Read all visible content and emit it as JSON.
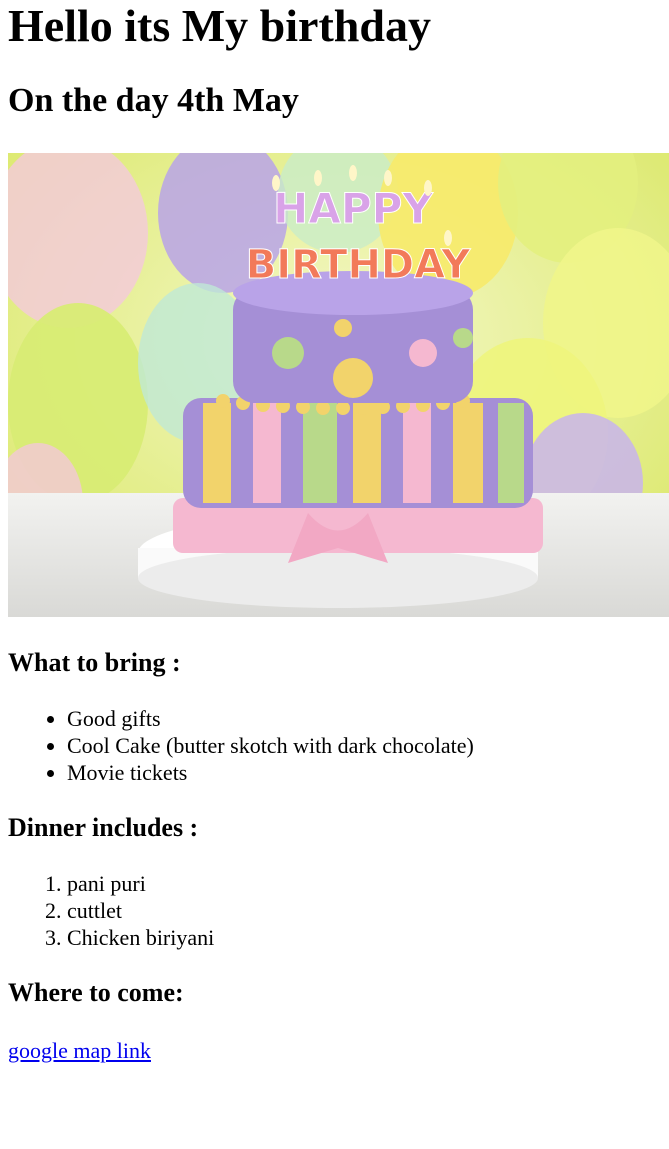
{
  "page": {
    "title": "Hello its My birthday",
    "subtitle": "On the day 4th May"
  },
  "hero_image": {
    "description_icon": "birthday-cake-icon",
    "cake_text_line1": "HAPPY",
    "cake_text_line2": "BIRTHDAY",
    "colors": {
      "background_yellow": "#e8f27a",
      "balloon_purple": "#b9a3e8",
      "cake_purple": "#a58fd6",
      "stripe_yellow": "#f2d36b",
      "stripe_green": "#b8d98a",
      "ribbon_pink": "#f5b8d0"
    }
  },
  "bring": {
    "heading": "What to bring :",
    "items": [
      "Good gifts",
      "Cool Cake (butter skotch with dark chocolate)",
      "Movie tickets"
    ]
  },
  "dinner": {
    "heading": "Dinner includes :",
    "items": [
      "pani puri",
      "cuttlet",
      "Chicken biriyani"
    ]
  },
  "where": {
    "heading": "Where to come:",
    "link_text": "google map link"
  }
}
